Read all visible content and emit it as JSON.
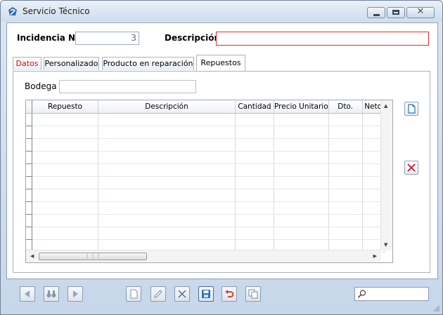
{
  "window": {
    "title": "Servicio Técnico"
  },
  "header": {
    "incidencia_label": "Incidencia Nº",
    "incidencia_value": "3",
    "descripcion_label": "Descripción",
    "descripcion_value": ""
  },
  "tabs": [
    {
      "label": "Datos",
      "color": "#d01010"
    },
    {
      "label": "Personalizado"
    },
    {
      "label": "Producto en reparación"
    },
    {
      "label": "Repuestos",
      "active": true
    }
  ],
  "repuestos": {
    "bodega_label": "Bodega",
    "bodega_value": "",
    "columns": [
      "Repuesto",
      "Descripción",
      "Cantidad",
      "Precio Unitario",
      "Dto.",
      "Neto"
    ],
    "row_count": 11
  },
  "colors": {
    "accent": "#2f6fb8",
    "required": "#e03030",
    "delete": "#d01818"
  }
}
